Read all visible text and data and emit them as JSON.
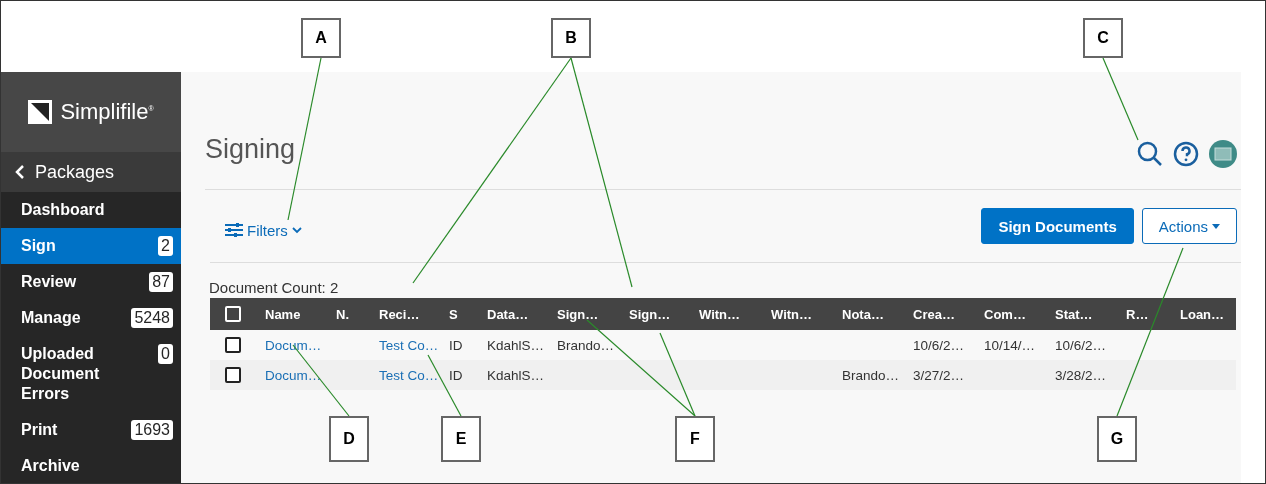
{
  "callouts": [
    {
      "label": "A"
    },
    {
      "label": "B"
    },
    {
      "label": "C"
    },
    {
      "label": "D"
    },
    {
      "label": "E"
    },
    {
      "label": "F"
    },
    {
      "label": "G"
    }
  ],
  "sidebar": {
    "logo": "Simplifile$^{®}$",
    "back": "Packages",
    "items": [
      {
        "label": "Dashboard",
        "selected": false
      },
      {
        "label": "Sign",
        "count": "2",
        "selected": true
      },
      {
        "label": "Review",
        "count": "87",
        "selected": false
      },
      {
        "label": "Manage",
        "count": "5248",
        "selected": false
      },
      {
        "label": "Uploaded Document Errors",
        "count": "0",
        "selected": false
      },
      {
        "label": "Print",
        "count": "1693",
        "selected": false
      },
      {
        "label": "Archive",
        "selected": false
      }
    ]
  },
  "header": {
    "title": "Signing"
  },
  "filters": {
    "label": "Filters"
  },
  "buttons": [
    {
      "label": "Sign Documents",
      "kind": "primary"
    },
    {
      "label": "Actions",
      "kind": "dropdown"
    }
  ],
  "document_count": "Document Count: 2",
  "table": {
    "header_checked": false,
    "columns": [
      {
        "label": "Name",
        "kind": "link"
      },
      {
        "label": "N.",
        "kind": "text"
      },
      {
        "label": "Reci…",
        "kind": "link"
      },
      {
        "label": "S",
        "kind": "text"
      },
      {
        "label": "Data…",
        "kind": "text"
      },
      {
        "label": "Sign…",
        "kind": "text"
      },
      {
        "label": "Sign…",
        "kind": "text"
      },
      {
        "label": "Witn…",
        "kind": "text"
      },
      {
        "label": "Witn…",
        "kind": "text"
      },
      {
        "label": "Nota…",
        "kind": "text"
      },
      {
        "label": "Crea…",
        "kind": "text"
      },
      {
        "label": "Com…",
        "kind": "text"
      },
      {
        "label": "Stat…",
        "kind": "text"
      },
      {
        "label": "R…",
        "kind": "text"
      },
      {
        "label": "Loan…",
        "kind": "text"
      }
    ],
    "rows": [
      {
        "checked": false,
        "cells": [
          "Docum…",
          null,
          "Test Co…",
          "ID",
          "KdahlS…",
          "Brando…",
          null,
          null,
          null,
          null,
          "10/6/2…",
          "10/14/…",
          "10/6/2…",
          null,
          null
        ]
      },
      {
        "checked": false,
        "cells": [
          "Docum…",
          null,
          "Test Co…",
          "ID",
          "KdahlS…",
          null,
          null,
          null,
          null,
          "Brando…",
          "3/27/2…",
          null,
          "3/28/2…",
          null,
          null
        ]
      }
    ]
  }
}
